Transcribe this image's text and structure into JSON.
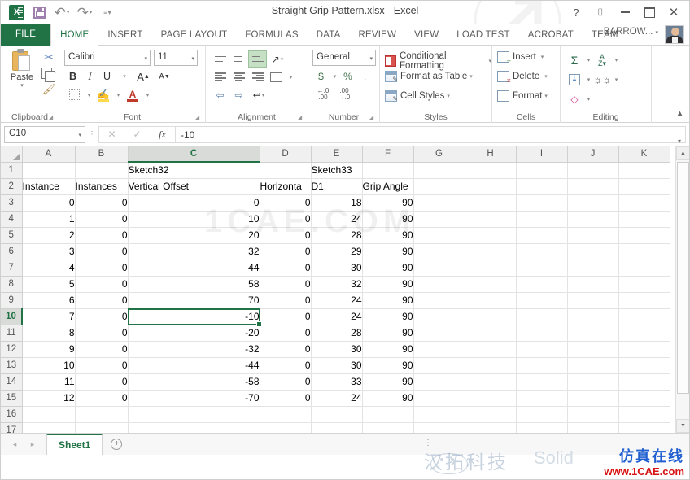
{
  "window": {
    "title": "Straight Grip Pattern.xlsx - Excel",
    "quick_access": [
      {
        "name": "excel-logo",
        "label": "X"
      },
      {
        "name": "save-icon",
        "label": ""
      },
      {
        "name": "undo-icon",
        "label": "↶"
      },
      {
        "name": "redo-icon",
        "label": "↷"
      },
      {
        "name": "customize-qat-icon",
        "label": "≡"
      }
    ],
    "controls": {
      "help": "?",
      "ribbon_display": "⌷",
      "minimize": "",
      "restore": "",
      "close": "✕"
    }
  },
  "ribbon": {
    "tabs": [
      {
        "label": "FILE",
        "state": "file"
      },
      {
        "label": "HOME",
        "state": "active"
      },
      {
        "label": "INSERT",
        "state": "normal"
      },
      {
        "label": "PAGE LAYOUT",
        "state": "normal"
      },
      {
        "label": "FORMULAS",
        "state": "normal"
      },
      {
        "label": "DATA",
        "state": "normal"
      },
      {
        "label": "REVIEW",
        "state": "normal"
      },
      {
        "label": "VIEW",
        "state": "normal"
      },
      {
        "label": "LOAD TEST",
        "state": "normal"
      },
      {
        "label": "ACROBAT",
        "state": "normal"
      },
      {
        "label": "TEAM",
        "state": "normal"
      }
    ],
    "user": "BARROW...",
    "groups": {
      "clipboard": {
        "label": "Clipboard",
        "paste": "Paste",
        "paste_caret": "▾",
        "cut": "✂",
        "copy": "copy",
        "format_painter": "✎"
      },
      "font": {
        "label": "Font",
        "font_name": "Calibri",
        "font_size": "11",
        "bold": "B",
        "italic": "I",
        "underline": "U",
        "grow_font": "A",
        "shrink_font": "A",
        "borders": "borders",
        "fill_color": "fill",
        "font_color": "A"
      },
      "alignment": {
        "label": "Alignment",
        "top_align": "top",
        "middle_align": "middle",
        "bottom_align": "bottom",
        "orientation": "orientation",
        "align_left": "left",
        "align_center": "center",
        "align_right": "right",
        "merge_center": "merge",
        "decrease_indent": "dec",
        "increase_indent": "inc",
        "wrap_text": "wrap"
      },
      "number": {
        "label": "Number",
        "format": "General",
        "accounting": "$",
        "percent": "%",
        "comma": ",",
        "increase_decimal": ".00",
        "decrease_decimal": ".00"
      },
      "styles": {
        "label": "Styles",
        "conditional_formatting": "Conditional Formatting",
        "format_as_table": "Format as Table",
        "cell_styles": "Cell Styles",
        "caret": "▾"
      },
      "cells": {
        "label": "Cells",
        "insert": "Insert",
        "delete": "Delete",
        "format": "Format",
        "caret": "▾"
      },
      "editing": {
        "label": "Editing",
        "autosum": "Σ",
        "fill": "⬇",
        "clear": "◆",
        "sort_filter": "AZ",
        "find_select": "🔍",
        "caret": "▾"
      },
      "collapse_ribbon": "▲"
    }
  },
  "formula_bar": {
    "name_box": "C10",
    "name_box_caret": "▾",
    "cancel": "✕",
    "enter": "✓",
    "insert_function": "fx",
    "value": "-10",
    "expand": "▾"
  },
  "grid": {
    "columns": [
      "A",
      "B",
      "C",
      "D",
      "E",
      "F",
      "G",
      "H",
      "I",
      "J",
      "K"
    ],
    "selected_column": "C",
    "selected_row": 10,
    "selected_cell": "C10",
    "rows": [
      {
        "n": 1,
        "A": "",
        "B": "",
        "C": "Sketch32",
        "D": "",
        "E": "Sketch33",
        "F": "",
        "G": "",
        "H": "",
        "I": "",
        "J": "",
        "K": ""
      },
      {
        "n": 2,
        "A": "Instance",
        "B": "Instances",
        "C": "Vertical Offset",
        "D": "Horizonta",
        "E": "D1",
        "F": "Grip Angle",
        "G": "",
        "H": "",
        "I": "",
        "J": "",
        "K": ""
      },
      {
        "n": 3,
        "A": "0",
        "B": "0",
        "C": "0",
        "D": "0",
        "E": "18",
        "F": "90",
        "G": "",
        "H": "",
        "I": "",
        "J": "",
        "K": ""
      },
      {
        "n": 4,
        "A": "1",
        "B": "0",
        "C": "10",
        "D": "0",
        "E": "24",
        "F": "90",
        "G": "",
        "H": "",
        "I": "",
        "J": "",
        "K": ""
      },
      {
        "n": 5,
        "A": "2",
        "B": "0",
        "C": "20",
        "D": "0",
        "E": "28",
        "F": "90",
        "G": "",
        "H": "",
        "I": "",
        "J": "",
        "K": ""
      },
      {
        "n": 6,
        "A": "3",
        "B": "0",
        "C": "32",
        "D": "0",
        "E": "29",
        "F": "90",
        "G": "",
        "H": "",
        "I": "",
        "J": "",
        "K": ""
      },
      {
        "n": 7,
        "A": "4",
        "B": "0",
        "C": "44",
        "D": "0",
        "E": "30",
        "F": "90",
        "G": "",
        "H": "",
        "I": "",
        "J": "",
        "K": ""
      },
      {
        "n": 8,
        "A": "5",
        "B": "0",
        "C": "58",
        "D": "0",
        "E": "32",
        "F": "90",
        "G": "",
        "H": "",
        "I": "",
        "J": "",
        "K": ""
      },
      {
        "n": 9,
        "A": "6",
        "B": "0",
        "C": "70",
        "D": "0",
        "E": "24",
        "F": "90",
        "G": "",
        "H": "",
        "I": "",
        "J": "",
        "K": ""
      },
      {
        "n": 10,
        "A": "7",
        "B": "0",
        "C": "-10",
        "D": "0",
        "E": "24",
        "F": "90",
        "G": "",
        "H": "",
        "I": "",
        "J": "",
        "K": ""
      },
      {
        "n": 11,
        "A": "8",
        "B": "0",
        "C": "-20",
        "D": "0",
        "E": "28",
        "F": "90",
        "G": "",
        "H": "",
        "I": "",
        "J": "",
        "K": ""
      },
      {
        "n": 12,
        "A": "9",
        "B": "0",
        "C": "-32",
        "D": "0",
        "E": "30",
        "F": "90",
        "G": "",
        "H": "",
        "I": "",
        "J": "",
        "K": ""
      },
      {
        "n": 13,
        "A": "10",
        "B": "0",
        "C": "-44",
        "D": "0",
        "E": "30",
        "F": "90",
        "G": "",
        "H": "",
        "I": "",
        "J": "",
        "K": ""
      },
      {
        "n": 14,
        "A": "11",
        "B": "0",
        "C": "-58",
        "D": "0",
        "E": "33",
        "F": "90",
        "G": "",
        "H": "",
        "I": "",
        "J": "",
        "K": ""
      },
      {
        "n": 15,
        "A": "12",
        "B": "0",
        "C": "-70",
        "D": "0",
        "E": "24",
        "F": "90",
        "G": "",
        "H": "",
        "I": "",
        "J": "",
        "K": ""
      },
      {
        "n": 16,
        "A": "",
        "B": "",
        "C": "",
        "D": "",
        "E": "",
        "F": "",
        "G": "",
        "H": "",
        "I": "",
        "J": "",
        "K": ""
      },
      {
        "n": 17,
        "A": "",
        "B": "",
        "C": "",
        "D": "",
        "E": "",
        "F": "",
        "G": "",
        "H": "",
        "I": "",
        "J": "",
        "K": ""
      }
    ],
    "watermark": "1CAE.COM",
    "scroll_up": "▲",
    "scroll_down": "▼"
  },
  "sheet_bar": {
    "prev": "◂",
    "next": "▸",
    "tabs": [
      "Sheet1"
    ],
    "add_sheet": "+",
    "split_dots": "⋮"
  },
  "watermarks": {
    "cn_text": "汉拓科技",
    "solid_text": "Solid",
    "blue_line1": "仿真在线",
    "blue_line2": "www.1CAE.com"
  },
  "colors": {
    "excel_green": "#217346",
    "tab_active_text": "#217346",
    "selection_border": "#217346",
    "header_fill": "#f0f0f0",
    "grid_line": "#e3e3e3"
  }
}
